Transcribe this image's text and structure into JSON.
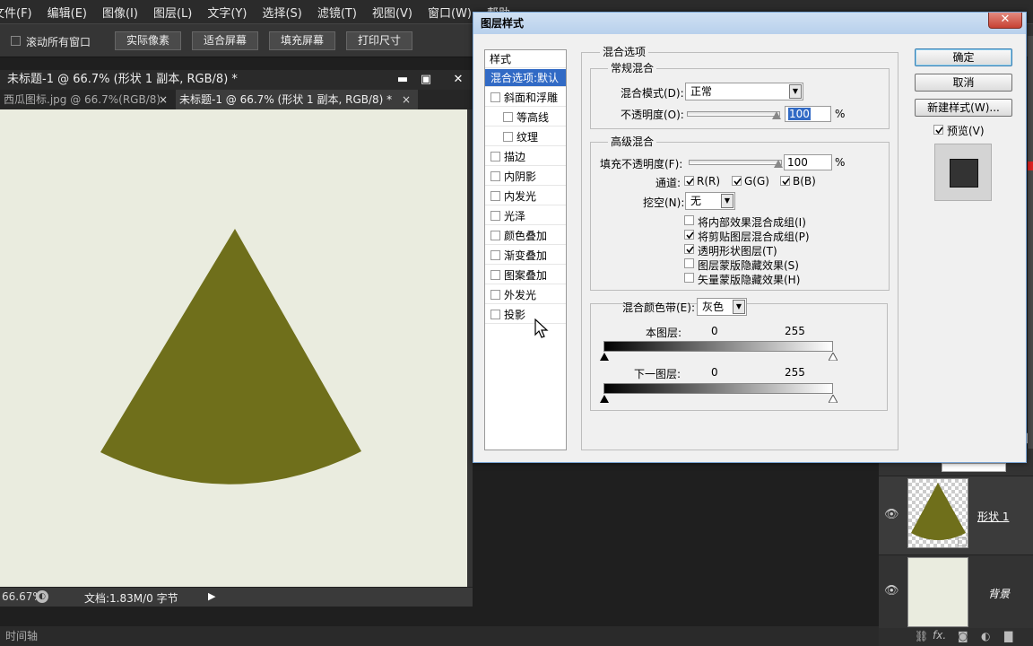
{
  "menu": [
    "文件(F)",
    "编辑(E)",
    "图像(I)",
    "图层(L)",
    "文字(Y)",
    "选择(S)",
    "滤镜(T)",
    "视图(V)",
    "窗口(W)",
    "帮助"
  ],
  "options": {
    "scroll_all_label": "滚动所有窗口",
    "buttons": [
      "实际像素",
      "适合屏幕",
      "填充屏幕",
      "打印尺寸"
    ]
  },
  "document": {
    "title": "未标题-1 @ 66.7% (形状 1 副本, RGB/8) *",
    "tabs": [
      "西瓜图标.jpg @ 66.7%(RGB/8)",
      "未标题-1 @ 66.7% (形状 1 副本, RGB/8) *"
    ],
    "zoom": "66.67%",
    "doc_info": "文档:1.83M/0 字节",
    "shape_color": "#6f6f1b",
    "canvas_color": "#eaecdf"
  },
  "timeline_label": "时间轴",
  "layers": {
    "items": [
      {
        "name": "形状 1"
      },
      {
        "name": "背景"
      }
    ],
    "partial_label": "状"
  },
  "dialog": {
    "title": "图层样式",
    "styles_header": "样式",
    "styles": [
      {
        "label": "混合选项:默认",
        "checkbox": false,
        "checked": false,
        "selected": true,
        "indent": false
      },
      {
        "label": "斜面和浮雕",
        "checkbox": true,
        "checked": false,
        "selected": false,
        "indent": false
      },
      {
        "label": "等高线",
        "checkbox": true,
        "checked": false,
        "selected": false,
        "indent": true
      },
      {
        "label": "纹理",
        "checkbox": true,
        "checked": false,
        "selected": false,
        "indent": true
      },
      {
        "label": "描边",
        "checkbox": true,
        "checked": false,
        "selected": false,
        "indent": false
      },
      {
        "label": "内阴影",
        "checkbox": true,
        "checked": false,
        "selected": false,
        "indent": false
      },
      {
        "label": "内发光",
        "checkbox": true,
        "checked": false,
        "selected": false,
        "indent": false
      },
      {
        "label": "光泽",
        "checkbox": true,
        "checked": false,
        "selected": false,
        "indent": false
      },
      {
        "label": "颜色叠加",
        "checkbox": true,
        "checked": false,
        "selected": false,
        "indent": false
      },
      {
        "label": "渐变叠加",
        "checkbox": true,
        "checked": false,
        "selected": false,
        "indent": false
      },
      {
        "label": "图案叠加",
        "checkbox": true,
        "checked": false,
        "selected": false,
        "indent": false
      },
      {
        "label": "外发光",
        "checkbox": true,
        "checked": false,
        "selected": false,
        "indent": false
      },
      {
        "label": "投影",
        "checkbox": true,
        "checked": false,
        "selected": false,
        "indent": false
      }
    ],
    "blend_options_title": "混合选项",
    "general_title": "常规混合",
    "blend_mode_label": "混合模式(D):",
    "blend_mode_value": "正常",
    "opacity_label": "不透明度(O):",
    "opacity_value": "100",
    "percent": "%",
    "advanced_title": "高级混合",
    "fill_opacity_label": "填充不透明度(F):",
    "fill_opacity_value": "100",
    "channels_label": "通道:",
    "channels": [
      "R(R)",
      "G(G)",
      "B(B)"
    ],
    "knockout_label": "挖空(N):",
    "knockout_value": "无",
    "checks": [
      {
        "label": "将内部效果混合成组(I)",
        "checked": false
      },
      {
        "label": "将剪贴图层混合成组(P)",
        "checked": true
      },
      {
        "label": "透明形状图层(T)",
        "checked": true
      },
      {
        "label": "图层蒙版隐藏效果(S)",
        "checked": false
      },
      {
        "label": "矢量蒙版隐藏效果(H)",
        "checked": false
      }
    ],
    "blend_if_label": "混合颜色带(E):",
    "blend_if_value": "灰色",
    "this_layer_label": "本图层:",
    "this_layer_min": "0",
    "this_layer_max": "255",
    "under_layer_label": "下一图层:",
    "under_layer_min": "0",
    "under_layer_max": "255",
    "ok": "确定",
    "cancel": "取消",
    "new_style": "新建样式(W)...",
    "preview_label": "预览(V)"
  }
}
